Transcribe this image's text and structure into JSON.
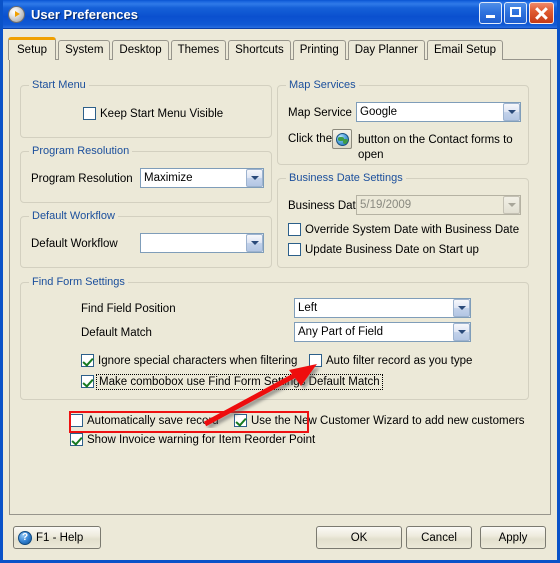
{
  "window": {
    "title": "User Preferences",
    "icon": "play-circle-icon",
    "controls": {
      "minimize": "minimize-button",
      "maximize": "maximize-button",
      "close": "close-button"
    }
  },
  "tabs": [
    {
      "label": "Setup",
      "active": true
    },
    {
      "label": "System",
      "active": false
    },
    {
      "label": "Desktop",
      "active": false
    },
    {
      "label": "Themes",
      "active": false
    },
    {
      "label": "Shortcuts",
      "active": false
    },
    {
      "label": "Printing",
      "active": false
    },
    {
      "label": "Day Planner",
      "active": false
    },
    {
      "label": "Email Setup",
      "active": false
    }
  ],
  "groups": {
    "start_menu": {
      "legend": "Start Menu",
      "keep_visible_label": "Keep Start Menu Visible",
      "keep_visible_checked": false
    },
    "program_resolution": {
      "legend": "Program Resolution",
      "field_label": "Program Resolution",
      "value": "Maximize"
    },
    "default_workflow": {
      "legend": "Default Workflow",
      "field_label": "Default Workflow",
      "value": ""
    },
    "map_services": {
      "legend": "Map Services",
      "field_label": "Map Service",
      "value": "Google",
      "hint_prefix": "Click the",
      "hint_suffix": "button on the Contact forms to open",
      "button_icon": "globe-icon"
    },
    "business_date": {
      "legend": "Business Date Settings",
      "field_label": "Business Date",
      "value": "5/19/2009",
      "disabled": true,
      "override_label": "Override System Date with Business Date",
      "override_checked": false,
      "update_label": "Update Business Date on Start up",
      "update_checked": false
    },
    "find_form": {
      "legend": "Find Form Settings",
      "position_label": "Find Field Position",
      "position_value": "Left",
      "match_label": "Default Match",
      "match_value": "Any Part of Field",
      "ignore_special_label": "Ignore special characters when filtering",
      "ignore_special_checked": true,
      "auto_filter_label": "Auto filter record as you type",
      "auto_filter_checked": false,
      "make_combobox_label": "Make combobox use Find Form Settings Default Match",
      "make_combobox_checked": true
    }
  },
  "misc_options": {
    "auto_save_label": "Automatically save record",
    "auto_save_checked": false,
    "new_customer_wizard_label": "Use the New Customer Wizard to add new customers",
    "new_customer_wizard_checked": true,
    "invoice_warning_label": "Show Invoice warning for Item Reorder Point",
    "invoice_warning_checked": true
  },
  "footer": {
    "help_label": "F1 - Help",
    "help_icon": "question-circle-icon",
    "ok_label": "OK",
    "cancel_label": "Cancel",
    "apply_label": "Apply"
  },
  "annotation": {
    "highlight_color": "#ee1111",
    "arrow_from": "make-combobox-checkbox",
    "arrow_to": "default-match-combobox"
  }
}
